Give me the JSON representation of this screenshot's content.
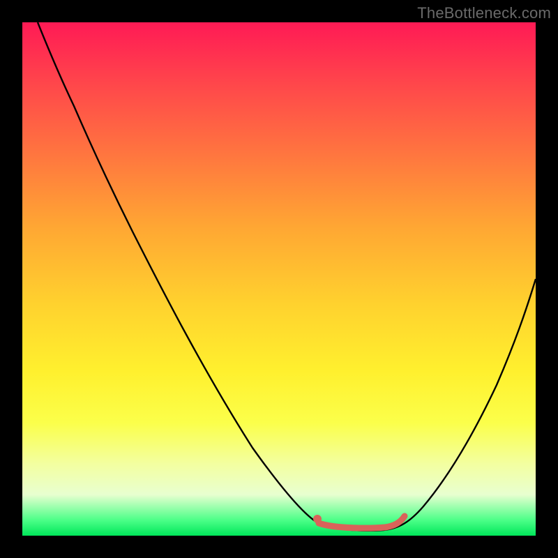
{
  "watermark": "TheBottleneck.com",
  "chart_data": {
    "type": "line",
    "title": "",
    "xlabel": "",
    "ylabel": "",
    "xlim": [
      0,
      100
    ],
    "ylim": [
      0,
      100
    ],
    "grid": false,
    "legend": false,
    "background": "rainbow-gradient",
    "series": [
      {
        "name": "bottleneck-curve",
        "color": "#000000",
        "x": [
          3,
          6,
          10,
          15,
          20,
          25,
          30,
          35,
          40,
          45,
          50,
          55,
          58,
          60,
          63,
          66,
          70,
          72,
          75,
          80,
          85,
          90,
          95,
          100
        ],
        "y": [
          100,
          96,
          90,
          83,
          75,
          67,
          59,
          51,
          43,
          35,
          27,
          18,
          12,
          8,
          4,
          2,
          1,
          1,
          2,
          7,
          15,
          25,
          37,
          50
        ]
      },
      {
        "name": "highlight-segment",
        "color": "#d9635a",
        "x": [
          58,
          60,
          62,
          64,
          66,
          68,
          70,
          71,
          72
        ],
        "y": [
          3,
          2,
          2,
          2,
          2,
          2,
          2,
          3,
          4
        ]
      }
    ],
    "markers": [
      {
        "name": "highlight-start-dot",
        "x": 58,
        "y": 3,
        "color": "#d9635a"
      }
    ]
  }
}
